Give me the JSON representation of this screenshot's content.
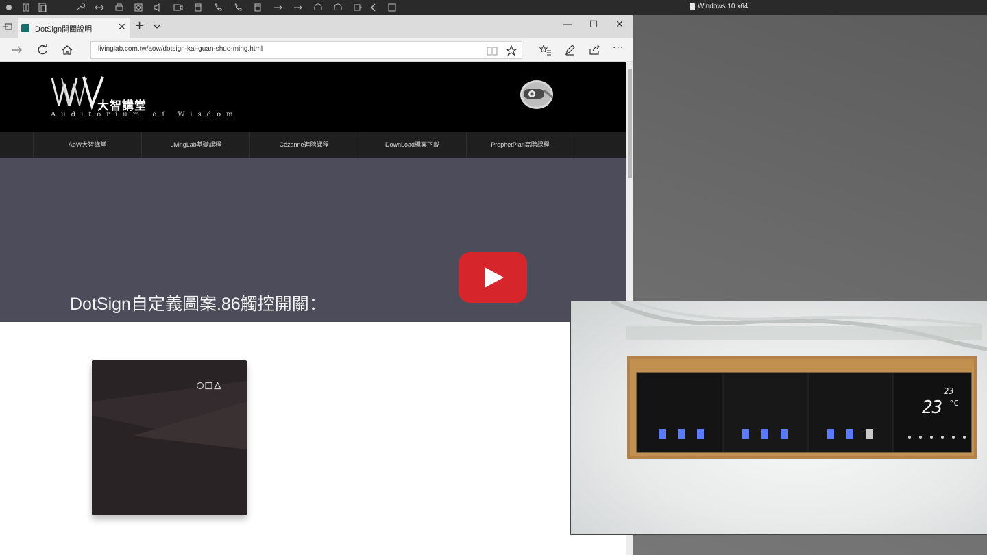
{
  "vm": {
    "title": "Windows 10 x64"
  },
  "browser": {
    "tab_title": "DotSign開關說明",
    "url": "livinglab.com.tw/aow/dotsign-kai-guan-shuo-ming.html",
    "window_controls": {
      "minimize": "—",
      "maximize": "☐",
      "close": "✕"
    },
    "more_label": "···"
  },
  "site": {
    "logo_cn": "大智講堂",
    "logo_en": "Auditorium of Wisdom",
    "nav": [
      "AoW大智講堂",
      "LivingLab基礎課程",
      "Cézanne進階課程",
      "DownLoad檔案下載",
      "ProphetPlan高階課程"
    ],
    "hero_title": "DotSign自定義圖案.86觸控開關："
  },
  "video": {
    "thermostat_temp": "23",
    "thermostat_unit": "°C",
    "thermostat_setpoint": "23",
    "colors": {
      "led": "#5b7bff",
      "panel": "#141414",
      "frame": "#b5814a"
    }
  },
  "icons": [
    "back-arrow-icon",
    "refresh-icon",
    "home-icon",
    "reading-view-icon",
    "favorite-star-icon",
    "favorites-hub-icon",
    "pen-icon",
    "share-icon",
    "more-icon",
    "youtube-play-icon",
    "robot-icon"
  ]
}
